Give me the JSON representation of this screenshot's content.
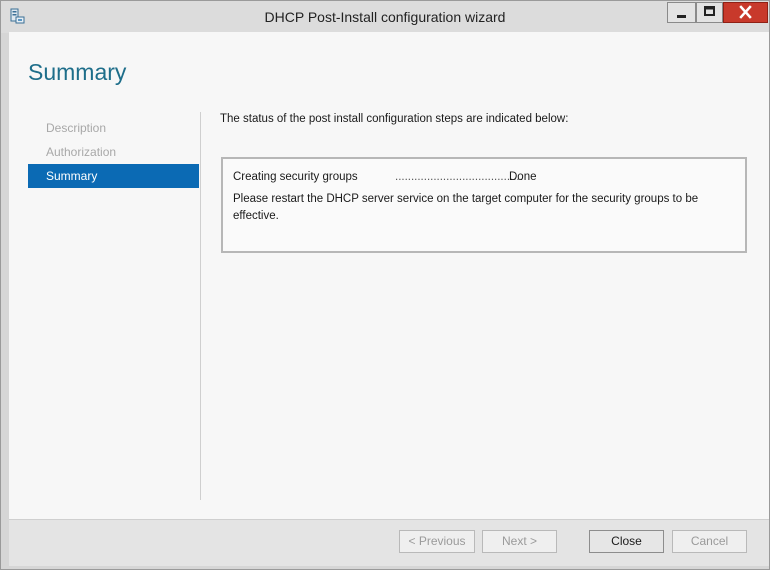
{
  "window": {
    "title": "DHCP Post-Install configuration wizard"
  },
  "page": {
    "heading": "Summary"
  },
  "nav": {
    "items": [
      {
        "label": "Description"
      },
      {
        "label": "Authorization"
      },
      {
        "label": "Summary",
        "active": true
      }
    ]
  },
  "main": {
    "intro": "The status of the post install configuration steps are indicated below:",
    "steps": [
      {
        "name": "Creating security groups",
        "dots": "........................................",
        "status": "Done"
      }
    ],
    "message": "Please restart the DHCP server service on the target computer for the security groups to be effective."
  },
  "footer": {
    "previous_label": "< Previous",
    "next_label": "Next >",
    "close_label": "Close",
    "cancel_label": "Cancel"
  },
  "colors": {
    "accent": "#0b6ab4",
    "heading": "#1e6e8a",
    "close_button": "#c8392b"
  },
  "icons": {
    "app": "dhcp-server-icon",
    "minimize": "minimize-icon",
    "maximize": "maximize-icon",
    "close": "close-icon"
  }
}
